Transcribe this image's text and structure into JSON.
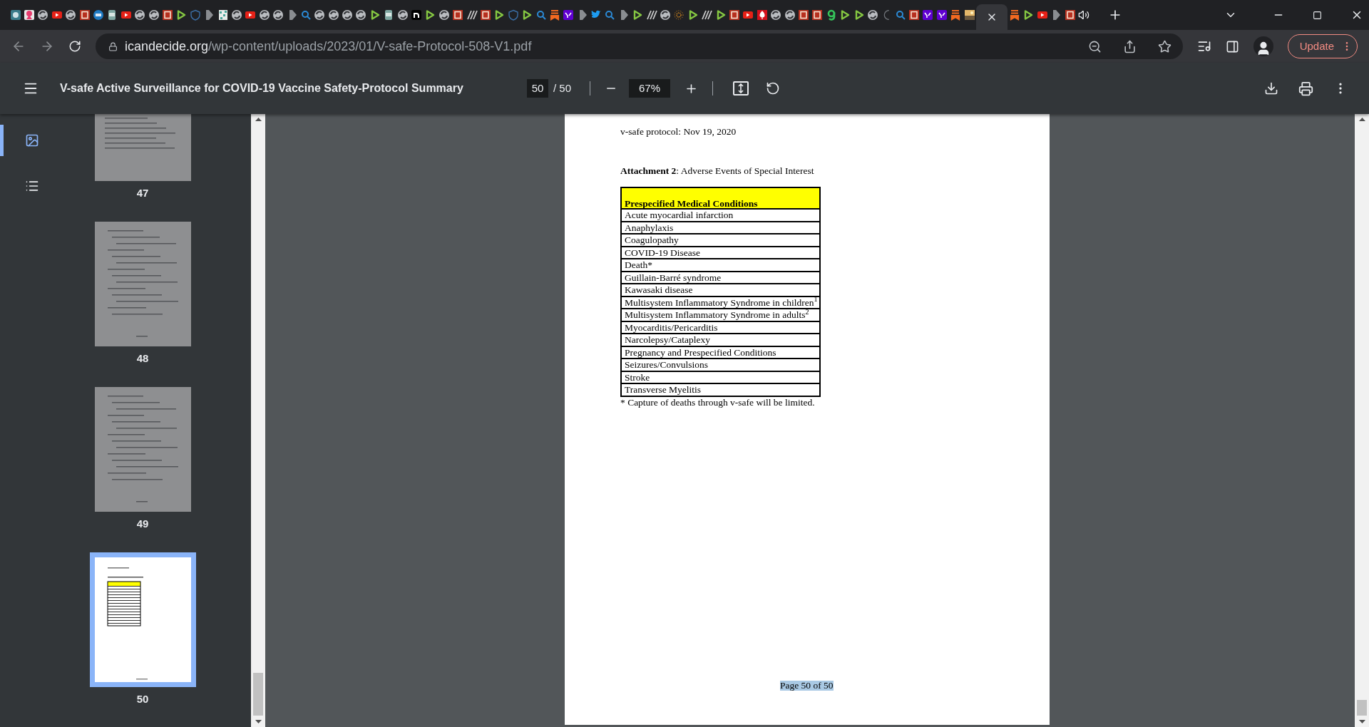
{
  "tab_strip": {
    "tabs": [
      {
        "kind": "globe",
        "selected": false
      },
      {
        "kind": "pink",
        "selected": false
      },
      {
        "kind": "swirl",
        "selected": false
      },
      {
        "kind": "video",
        "selected": false
      },
      {
        "kind": "swirl",
        "selected": false
      },
      {
        "kind": "b",
        "selected": false
      },
      {
        "kind": "jn",
        "selected": false
      },
      {
        "kind": "jar",
        "selected": false
      },
      {
        "kind": "video",
        "selected": false
      },
      {
        "kind": "swirl",
        "selected": false
      },
      {
        "kind": "swirl",
        "selected": false
      },
      {
        "kind": "b",
        "selected": false
      },
      {
        "kind": "play",
        "selected": false
      },
      {
        "kind": "shield",
        "selected": false
      },
      {
        "kind": "chevron",
        "selected": false
      },
      {
        "kind": "qr",
        "selected": false
      },
      {
        "kind": "swirl",
        "selected": false
      },
      {
        "kind": "video",
        "selected": false
      },
      {
        "kind": "swirl",
        "selected": false
      },
      {
        "kind": "swirl",
        "selected": false
      },
      {
        "kind": "chevron",
        "selected": false
      },
      {
        "kind": "search",
        "selected": false
      },
      {
        "kind": "swirl",
        "selected": false
      },
      {
        "kind": "swirl",
        "selected": false
      },
      {
        "kind": "swirl",
        "selected": false
      },
      {
        "kind": "swirl",
        "selected": false
      },
      {
        "kind": "play",
        "selected": false
      },
      {
        "kind": "jar",
        "selected": false
      },
      {
        "kind": "swirl",
        "selected": false
      },
      {
        "kind": "arch",
        "selected": false
      },
      {
        "kind": "play",
        "selected": false
      },
      {
        "kind": "swirl",
        "selected": false
      },
      {
        "kind": "b",
        "selected": false
      },
      {
        "kind": "stripes",
        "selected": false
      },
      {
        "kind": "b",
        "selected": false
      },
      {
        "kind": "play",
        "selected": false
      },
      {
        "kind": "shield",
        "selected": false
      },
      {
        "kind": "play",
        "selected": false
      },
      {
        "kind": "search",
        "selected": false
      },
      {
        "kind": "bookmark",
        "selected": false
      },
      {
        "kind": "purple",
        "selected": false
      },
      {
        "kind": "chevron",
        "selected": false
      },
      {
        "kind": "bird",
        "selected": false
      },
      {
        "kind": "search",
        "selected": false
      },
      {
        "kind": "chevron",
        "selected": false
      },
      {
        "kind": "play",
        "selected": false
      },
      {
        "kind": "stripes",
        "selected": false
      },
      {
        "kind": "swirl",
        "selected": false
      },
      {
        "kind": "sun",
        "selected": false
      },
      {
        "kind": "play",
        "selected": false
      },
      {
        "kind": "stripes",
        "selected": false
      },
      {
        "kind": "play",
        "selected": false
      },
      {
        "kind": "b",
        "selected": false
      },
      {
        "kind": "video",
        "selected": false
      },
      {
        "kind": "pin",
        "selected": false
      },
      {
        "kind": "swirl",
        "selected": false
      },
      {
        "kind": "swirl",
        "selected": false
      },
      {
        "kind": "b",
        "selected": false
      },
      {
        "kind": "b",
        "selected": false
      },
      {
        "kind": "hook",
        "selected": false
      },
      {
        "kind": "play",
        "selected": false
      },
      {
        "kind": "play",
        "selected": false
      },
      {
        "kind": "swirl",
        "selected": false
      },
      {
        "kind": "moon",
        "selected": false
      },
      {
        "kind": "search",
        "selected": false
      },
      {
        "kind": "b",
        "selected": false
      },
      {
        "kind": "purple",
        "selected": false
      },
      {
        "kind": "purple",
        "selected": false
      },
      {
        "kind": "bookmark",
        "selected": false
      },
      {
        "kind": "image",
        "selected": false
      },
      {
        "kind": "blank",
        "selected": true
      },
      {
        "kind": "bookmark",
        "selected": false
      },
      {
        "kind": "play",
        "selected": false
      },
      {
        "kind": "video",
        "selected": false
      },
      {
        "kind": "chevron",
        "selected": false
      },
      {
        "kind": "b",
        "selected": false
      },
      {
        "kind": "speaker",
        "selected": false
      }
    ]
  },
  "address_bar": {
    "domain": "icandecide.org",
    "path": "/wp-content/uploads/2023/01/V-safe-Protocol-508-V1.pdf",
    "update_button": "Update"
  },
  "pdf_toolbar": {
    "title": "V-safe Active Surveillance for COVID-19 Vaccine Safety-Protocol Summary",
    "page_input": "50",
    "page_total": "/ 50",
    "zoom": "67%"
  },
  "sidebar": {
    "views": [
      {
        "kind": "thumbnails",
        "selected": true
      },
      {
        "kind": "outline",
        "selected": false
      }
    ],
    "thumbnails": [
      {
        "label": "47",
        "selected": false
      },
      {
        "label": "48",
        "selected": false
      },
      {
        "label": "49",
        "selected": false
      },
      {
        "label": "50",
        "selected": true
      }
    ]
  },
  "page": {
    "header": "v-safe protocol: Nov 19, 2020",
    "heading": "**Attachment 2**: Adverse Events of Special Interest",
    "table": {
      "header": "Prespecified Medical Conditions",
      "rows": [
        "Acute myocardial infarction",
        "Anaphylaxis",
        "Coagulopathy",
        "COVID-19 Disease",
        "Death*",
        "Guillain-Barré syndrome",
        "Kawasaki disease",
        "Multisystem Inflammatory Syndrome in children$^{1}$",
        "Multisystem Inflammatory Syndrome in adults$^{2}$",
        "Myocarditis/Pericarditis",
        "Narcolepsy/Cataplexy",
        "Pregnancy and Prespecified Conditions",
        "Seizures/Convulsions",
        "Stroke",
        "Transverse Myelitis"
      ]
    },
    "footnote": "* Capture of deaths through v-safe will be limited.",
    "footer": "Page 50 of 50"
  }
}
